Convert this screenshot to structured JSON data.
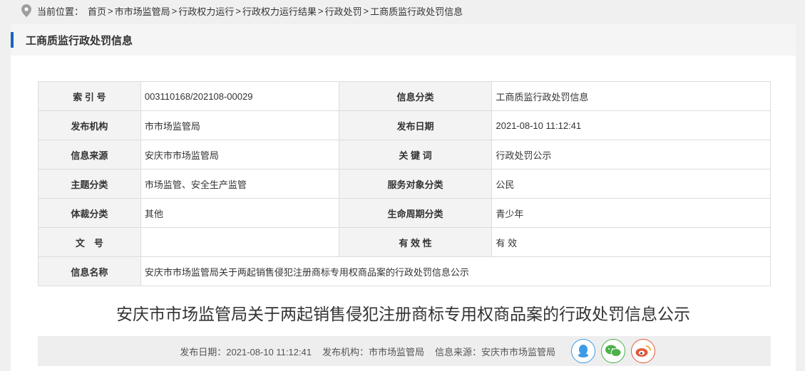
{
  "breadcrumb": {
    "prefix": "当前位置：",
    "items": [
      "首页",
      "市市场监管局",
      "行政权力运行",
      "行政权力运行结果",
      "行政处罚",
      "工商质监行政处罚信息"
    ],
    "separators": [
      ">",
      ">",
      ">",
      ">",
      ">"
    ]
  },
  "panel": {
    "title": "工商质监行政处罚信息"
  },
  "info": {
    "rows": [
      {
        "l1": "索 引 号",
        "v1": "003110168/202108-00029",
        "l2": "信息分类",
        "v2": "工商质监行政处罚信息"
      },
      {
        "l1": "发布机构",
        "v1": "市市场监管局",
        "l2": "发布日期",
        "v2": "2021-08-10 11:12:41"
      },
      {
        "l1": "信息来源",
        "v1": "安庆市市场监管局",
        "l2": "关 键 词",
        "v2": "行政处罚公示"
      },
      {
        "l1": "主题分类",
        "v1": "市场监管、安全生产监管",
        "l2": "服务对象分类",
        "v2": "公民"
      },
      {
        "l1": "体裁分类",
        "v1": "其他",
        "l2": "生命周期分类",
        "v2": "青少年"
      },
      {
        "l1": "文　号",
        "v1": "",
        "l2": "有 效 性",
        "v2": "有 效"
      }
    ],
    "name_label": "信息名称",
    "name_value": "安庆市市场监管局关于两起销售侵犯注册商标专用权商品案的行政处罚信息公示"
  },
  "document": {
    "title": "安庆市市场监管局关于两起销售侵犯注册商标专用权商品案的行政处罚信息公示"
  },
  "meta": {
    "date": "发布日期：2021-08-10 11:12:41",
    "org": "发布机构：市市场监管局",
    "source": "信息来源：安庆市市场监管局"
  },
  "share_icons": [
    "qq-icon",
    "wechat-icon",
    "weibo-icon"
  ],
  "colors": {
    "accent": "#1565c0",
    "qq": "#3b9be6",
    "wechat": "#4db04a",
    "weibo": "#e35a3a"
  }
}
